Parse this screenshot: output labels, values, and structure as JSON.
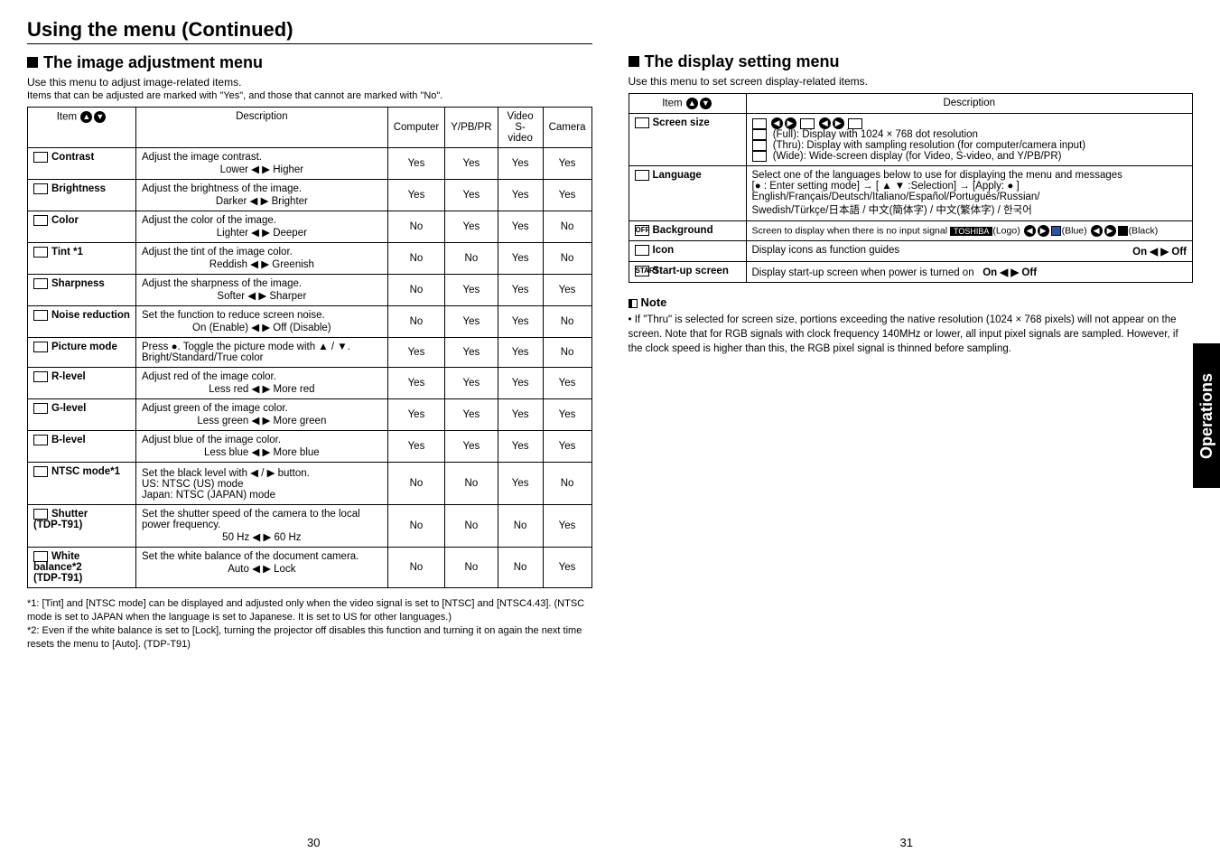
{
  "main_heading": "Using the menu (Continued)",
  "left": {
    "title": "The image adjustment menu",
    "intro1": "Use this menu to adjust image-related items.",
    "intro2": "Items that can be adjusted are marked with  \"Yes\", and those that cannot are marked with \"No\".",
    "headers": {
      "item": "Item",
      "desc": "Description",
      "c1": "Computer",
      "c2": "Y/PB/PR",
      "c3": "Video\nS-video",
      "c4": "Camera"
    },
    "rows": [
      {
        "item": "Contrast",
        "desc": "Adjust the image contrast.",
        "line2": "Lower ◀ ▶ Higher",
        "c": [
          "Yes",
          "Yes",
          "Yes",
          "Yes"
        ]
      },
      {
        "item": "Brightness",
        "desc": "Adjust the brightness of the image.",
        "line2": "Darker ◀ ▶ Brighter",
        "c": [
          "Yes",
          "Yes",
          "Yes",
          "Yes"
        ]
      },
      {
        "item": "Color",
        "desc": "Adjust the color of the image.",
        "line2": "Lighter ◀ ▶ Deeper",
        "c": [
          "No",
          "Yes",
          "Yes",
          "No"
        ]
      },
      {
        "item": "Tint *1",
        "desc": "Adjust the tint of the image color.",
        "line2": "Reddish ◀ ▶ Greenish",
        "c": [
          "No",
          "No",
          "Yes",
          "No"
        ]
      },
      {
        "item": "Sharpness",
        "desc": "Adjust the sharpness of the image.",
        "line2": "Softer ◀ ▶ Sharper",
        "c": [
          "No",
          "Yes",
          "Yes",
          "Yes"
        ]
      },
      {
        "item": "Noise reduction",
        "desc": "Set the function to reduce screen noise.",
        "line2": "On (Enable) ◀ ▶ Off (Disable)",
        "c": [
          "No",
          "Yes",
          "Yes",
          "No"
        ]
      },
      {
        "item": "Picture mode",
        "desc": "Press ●. Toggle the picture mode with ▲ / ▼.\nBright/Standard/True color",
        "line2": "",
        "c": [
          "Yes",
          "Yes",
          "Yes",
          "No"
        ]
      },
      {
        "item": "R-level",
        "desc": "Adjust red of the image color.",
        "line2": "Less red ◀ ▶ More red",
        "c": [
          "Yes",
          "Yes",
          "Yes",
          "Yes"
        ]
      },
      {
        "item": "G-level",
        "desc": "Adjust green of the image color.",
        "line2": "Less green ◀ ▶ More green",
        "c": [
          "Yes",
          "Yes",
          "Yes",
          "Yes"
        ]
      },
      {
        "item": "B-level",
        "desc": "Adjust blue of the image color.",
        "line2": "Less blue ◀ ▶ More blue",
        "c": [
          "Yes",
          "Yes",
          "Yes",
          "Yes"
        ]
      },
      {
        "item": "NTSC mode*1",
        "desc": "Set the black level with ◀ / ▶ button.\nUS:      NTSC (US) mode\nJapan:  NTSC (JAPAN) mode",
        "line2": "",
        "c": [
          "No",
          "No",
          "Yes",
          "No"
        ]
      },
      {
        "item": "Shutter\n(TDP-T91)",
        "desc": "Set the shutter speed of the camera to the local power frequency.",
        "line2": "50 Hz ◀ ▶ 60 Hz",
        "c": [
          "No",
          "No",
          "No",
          "Yes"
        ]
      },
      {
        "item": "White balance*2\n(TDP-T91)",
        "desc": "Set the white balance of the document camera.",
        "line2": "Auto ◀ ▶ Lock",
        "c": [
          "No",
          "No",
          "No",
          "Yes"
        ]
      }
    ],
    "foot1": "*1: [Tint] and [NTSC mode] can be displayed and adjusted only when the video signal is set to [NTSC] and [NTSC4.43]. (NTSC mode is set to JAPAN when the language is set to Japanese. It is set to US for other languages.)",
    "foot2": "*2: Even if the white balance is set to [Lock], turning  the projector off disables this function and turning it on again the next time resets the menu to [Auto]. (TDP-T91)",
    "page": "30"
  },
  "right": {
    "title": "The display setting menu",
    "intro": "Use this menu to set screen display-related items.",
    "headers": {
      "item": "Item",
      "desc": "Description"
    },
    "rows": [
      {
        "item": "Screen size",
        "desc_lines": [
          "(Full):  Display with 1024 × 768 dot resolution",
          "(Thru): Display with sampling resolution (for computer/camera input)",
          "(Wide): Wide-screen display (for Video, S-video, and Y/PB/PR)"
        ]
      },
      {
        "item": "Language",
        "desc_lines": [
          "Select one of the languages below to use for displaying the menu and messages",
          "[● : Enter setting mode] → [ ▲ ▼ :Selection] → [Apply: ● ]",
          "English/Français/Deutsch/Italiano/Español/Português/Russian/",
          "Swedish/Türkçe/日本語 / 中文(簡体字) / 中文(繁体字) / 한국어"
        ]
      },
      {
        "item": "Background",
        "desc": "Screen to display when there is no input signal",
        "label_logo": "TOSHIBA",
        "opt_logo": "(Logo)",
        "opt_blue": "(Blue)",
        "opt_black": "(Black)"
      },
      {
        "item": "Icon",
        "desc": "Display icons as function guides",
        "onoff": "On ◀ ▶ Off"
      },
      {
        "item": "Start-up screen",
        "desc": "Display start-up screen when power is turned on",
        "onoff": "On ◀ ▶ Off"
      }
    ],
    "note_title": "Note",
    "note_body": "• If \"Thru\" is selected for screen size, portions exceeding the native resolution (1024 × 768 pixels) will not appear on the screen. Note that for RGB signals with clock frequency 140MHz or lower, all input pixel signals are sampled. However, if the clock speed is higher than this, the RGB pixel signal is thinned before sampling.",
    "ops": "Operations",
    "page": "31"
  }
}
